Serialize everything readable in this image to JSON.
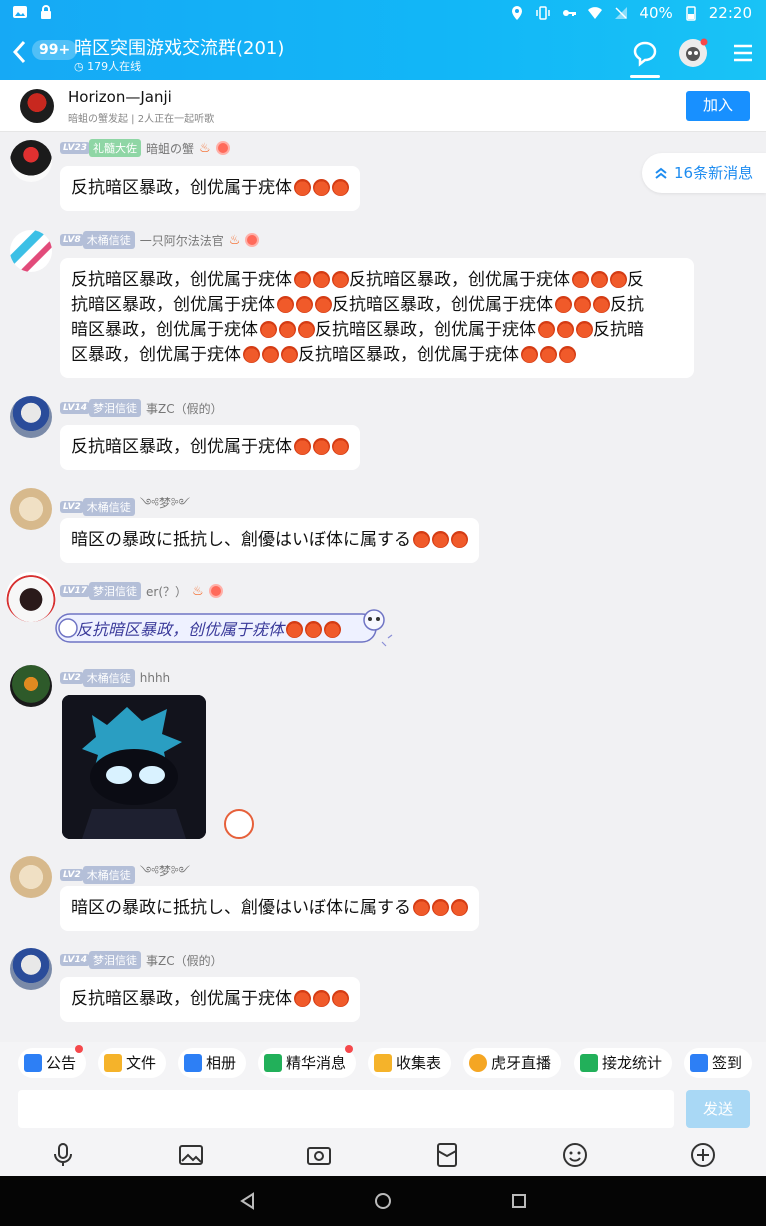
{
  "status_bar": {
    "battery": "40%",
    "time": "22:20"
  },
  "header": {
    "unread_badge": "99+",
    "group_title": "暗区突围游戏交流群(201)",
    "online": "179人在线"
  },
  "listen_bar": {
    "title": "Horizon—Janji",
    "subtitle": "暗蛆の蟹发起 | 2人正在一起听歌",
    "join_label": "加入"
  },
  "new_messages": "16条新消息",
  "messages": [
    {
      "level": "LV23",
      "rank": "礼髓大佐",
      "name": "暗蛆の蟹",
      "text": "反抗暗区暴政，创优属于疣体"
    },
    {
      "level": "LV8",
      "rank": "木桶信徒",
      "name": "一只阿尔法法官",
      "lines": [
        "反抗暗区暴政，创优属于疣体",
        "反抗暗区暴政，创优属于疣体",
        "反",
        "抗暗区暴政，创优属于疣体",
        "反抗暗区暴政，创优属于疣体",
        "反抗",
        "暗区暴政，创优属于疣体",
        "反抗暗区暴政，创优属于疣体",
        "反抗暗",
        "区暴政，创优属于疣体",
        "反抗暗区暴政，创优属于疣体"
      ]
    },
    {
      "level": "LV14",
      "rank": "梦泪信徒",
      "name": "事ZC（假的）",
      "text": "反抗暗区暴政，创优属于疣体"
    },
    {
      "level": "LV2",
      "rank": "木桶信徒",
      "name": "༺梦༻",
      "text": "暗区の暴政に抵抗し、創優はいぼ体に属する"
    },
    {
      "level": "LV17",
      "rank": "梦泪信徒",
      "name": "er(？）",
      "text": "反抗暗区暴政，创优属于疣体"
    },
    {
      "level": "LV2",
      "rank": "木桶信徒",
      "name": "hhhh"
    },
    {
      "level": "LV2",
      "rank": "木桶信徒",
      "name": "༺梦༻",
      "text": "暗区の暴政に抵抗し、創優はいぼ体に属する"
    },
    {
      "level": "LV14",
      "rank": "梦泪信徒",
      "name": "事ZC（假的）",
      "text": "反抗暗区暴政，创优属于疣体"
    }
  ],
  "toolbar": {
    "items": [
      "公告",
      "文件",
      "相册",
      "精华消息",
      "收集表",
      "虎牙直播",
      "接龙统计",
      "签到"
    ]
  },
  "input": {
    "placeholder": "",
    "send_label": "发送"
  },
  "colors": {
    "header": "#16a9f5",
    "accent": "#1890ff",
    "background": "#f1f1f3"
  },
  "icons": {
    "bottom": [
      "microphone-icon",
      "image-icon",
      "camera-icon",
      "red-packet-icon",
      "emoji-icon",
      "plus-icon"
    ],
    "nav": [
      "back-triangle-icon",
      "home-circle-icon",
      "recents-square-icon"
    ]
  }
}
